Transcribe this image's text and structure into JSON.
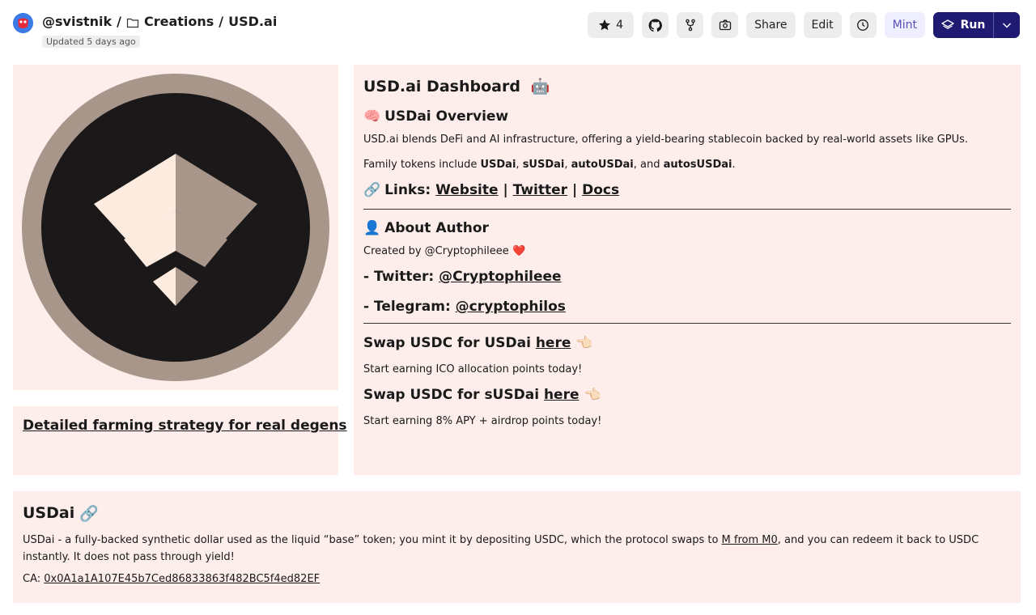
{
  "header": {
    "user": "@svistnik",
    "sep1": "/",
    "folder": "Creations",
    "sep2": "/",
    "project": "USD.ai",
    "updated": "Updated 5 days ago"
  },
  "toolbar": {
    "star_count": "4",
    "share_label": "Share",
    "edit_label": "Edit",
    "mint_label": "Mint",
    "run_label": "Run"
  },
  "farm": {
    "link": "Detailed farming strategy for real degens",
    "emoji": "🧑‍🌾"
  },
  "dashboard": {
    "title": "USD.ai Dashboard",
    "title_emoji": "🤖",
    "overview_emoji": "🧠",
    "overview_heading": "USDai Overview",
    "overview_text": "USD.ai blends DeFi and AI infrastructure, offering a yield-bearing stablecoin backed by real-world assets like GPUs.",
    "family_prefix": "Family tokens include ",
    "family_t1": "USDai",
    "family_c1": ", ",
    "family_t2": "sUSDai",
    "family_c2": ", ",
    "family_t3": "autoUSDai",
    "family_c3": ", and ",
    "family_t4": "autosUSDai",
    "family_end": ".",
    "links_emoji": "🔗",
    "links_label": "Links:",
    "link_website": "Website",
    "link_twitter": "Twitter",
    "link_docs": "Docs",
    "link_sep": "|",
    "author_emoji": "👤",
    "author_heading": "About Author",
    "created_by": "Created by @Cryptophileee",
    "created_emoji": "❤️",
    "twitter_label": "- Twitter:",
    "twitter_handle": "@Cryptophileee",
    "telegram_label": "- Telegram:",
    "telegram_handle": "@cryptophilos",
    "swap1_text": "Swap USDC for USDai",
    "swap1_link": "here",
    "swap1_emoji": "👈🏻",
    "swap1_sub": "Start earning ICO allocation points today!",
    "swap2_text": "Swap USDC for sUSDai",
    "swap2_link": "here",
    "swap2_emoji": "👈🏻",
    "swap2_sub": "Start earning 8% APY + airdrop points today!"
  },
  "usdai": {
    "title": "USDai",
    "title_emoji": "🔗",
    "desc_pre": "USDai - a fully-backed synthetic dollar used as the liquid “base” token; you mint it by depositing USDC, which the protocol swaps to ",
    "desc_link": "M from M0",
    "desc_post": ", and you can redeem it back to USDC instantly. It does not pass through yield!",
    "ca_label": "CA:",
    "ca_address": "0x0A1a1A107E45b7Ced86833863f482BC5f4ed82EF"
  },
  "colors": {
    "panel_bg": "#fdeeec",
    "logo_ring": "#a8968a",
    "logo_core": "#1a1818",
    "logo_light": "#fdebe0",
    "run_bg": "#1f1b73"
  }
}
